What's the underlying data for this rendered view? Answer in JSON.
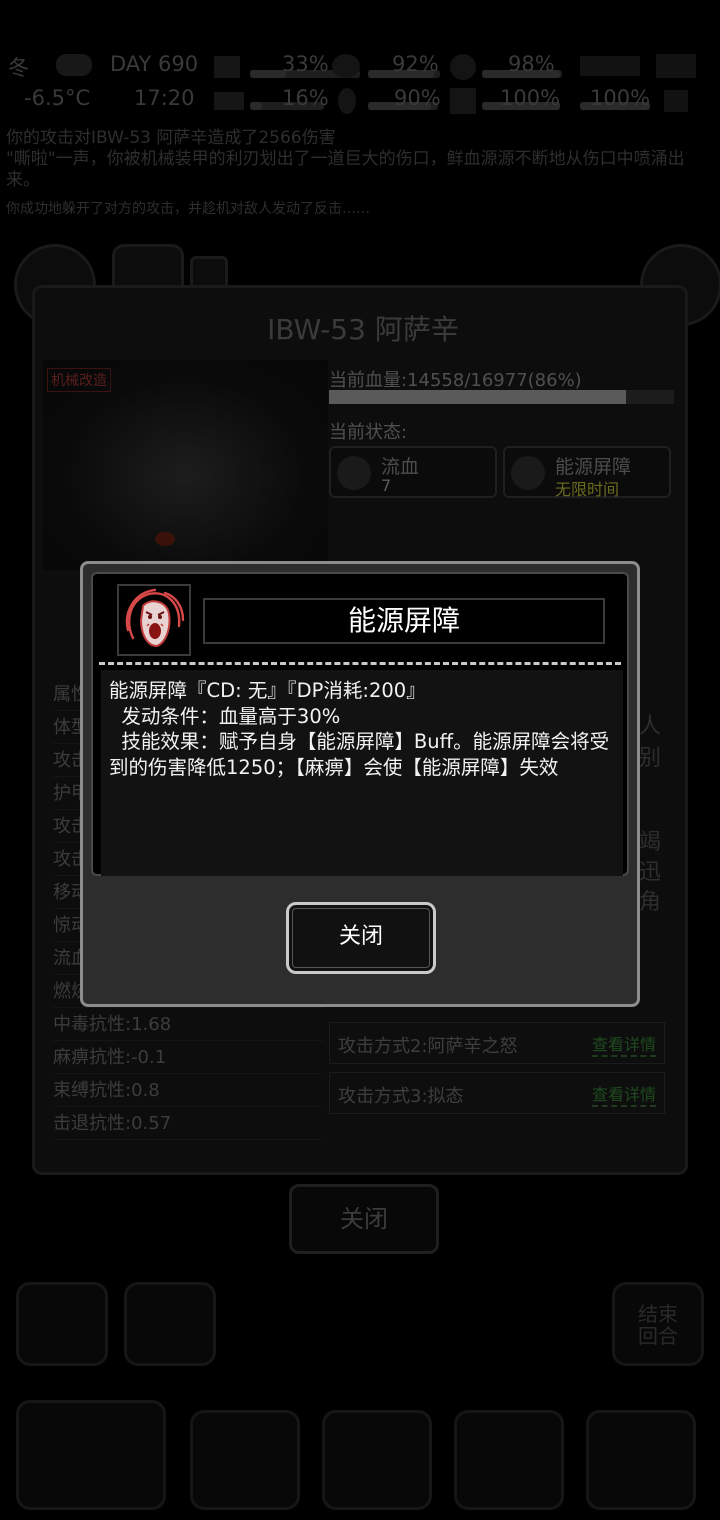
{
  "hud": {
    "row1": [
      "冬",
      "DAY 690",
      "33%",
      "92%",
      "98%"
    ],
    "row2": [
      "-6.5°C",
      "17:20",
      "16%",
      "90%",
      "100%",
      "100%"
    ]
  },
  "log_lines": [
    "你的攻击对IBW-53 阿萨辛造成了2566伤害",
    "\"嘶啦\"一声，你被机械装甲的利刃划出了一道巨大的伤口，鲜血源源不断地从伤口中喷涌出来。",
    "你成功地躲开了对方的攻击，并趁机对敌人发动了反击……"
  ],
  "enemy_dialog": {
    "title": "IBW-53 阿萨辛",
    "tag": "机械改造",
    "hp_label": "当前血量:14558/16977(86%)",
    "hp_fraction": 0.86,
    "state_label": "当前状态:",
    "statuses": [
      {
        "name": "流血",
        "value": "7",
        "value_color": "#5a5a5a"
      },
      {
        "name": "能源屏障",
        "value": "无限时间",
        "value_color": "#6a6a1e"
      }
    ],
    "attributes_head": "属性",
    "attributes": [
      "体型",
      "攻击",
      "护甲",
      "攻击",
      "攻击",
      "移动",
      "惊动",
      "流血",
      "燃烧",
      "中毒抗性:1.68",
      "麻痹抗性:-0.1",
      "束缚抗性:0.8",
      "击退抗性:0.57"
    ],
    "side_text": [
      "人",
      "别",
      "竭",
      "迅",
      "角"
    ],
    "attacks": [
      {
        "label": "攻击方式2:阿萨辛之怒",
        "button": "查看详情"
      },
      {
        "label": "攻击方式3:拟态",
        "button": "查看详情"
      }
    ],
    "close_label": "关闭"
  },
  "bottom_labels": {
    "end_turn": "结束\n回合"
  },
  "skill_popup": {
    "title": "能源屏障",
    "description_lines": [
      "能源屏障『CD: 无』『DP消耗:200』",
      "  发动条件：血量高于30%",
      "  技能效果：赋予自身【能源屏障】Buff。能源屏障会将受到的伤害降低1250；【麻痹】会使【能源屏障】失效"
    ],
    "close_label": "关闭",
    "icon": "screaming-face-icon",
    "icon_color": "#e05050"
  }
}
